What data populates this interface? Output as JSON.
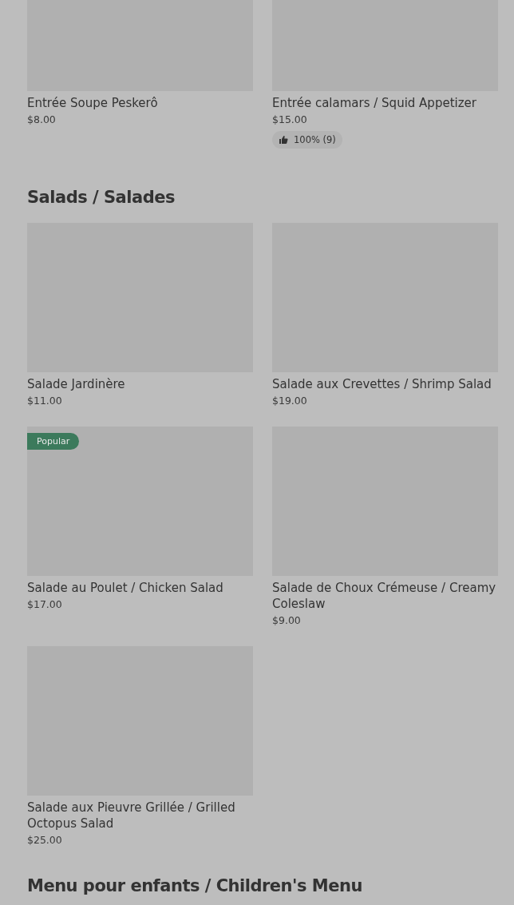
{
  "sections": [
    {
      "items": [
        {
          "name": "Entrée Soupe Peskerô",
          "price": "$8.00"
        },
        {
          "name": "Entrée calamars / Squid Appetizer",
          "price": "$15.00",
          "rating": "100% (9)"
        }
      ]
    },
    {
      "heading": "Salads / Salades",
      "items": [
        {
          "name": "Salade Jardinère",
          "price": "$11.00"
        },
        {
          "name": "Salade aux Crevettes / Shrimp Salad",
          "price": "$19.00"
        },
        {
          "name": "Salade au Poulet / Chicken Salad",
          "price": "$17.00",
          "badge": "Popular"
        },
        {
          "name": "Salade de Choux Crémeuse / Creamy Coleslaw",
          "price": "$9.00"
        },
        {
          "name": "Salade aux Pieuvre Grillée / Grilled Octopus Salad",
          "price": "$25.00"
        }
      ]
    },
    {
      "heading": "Menu pour enfants / Children's Menu"
    }
  ]
}
